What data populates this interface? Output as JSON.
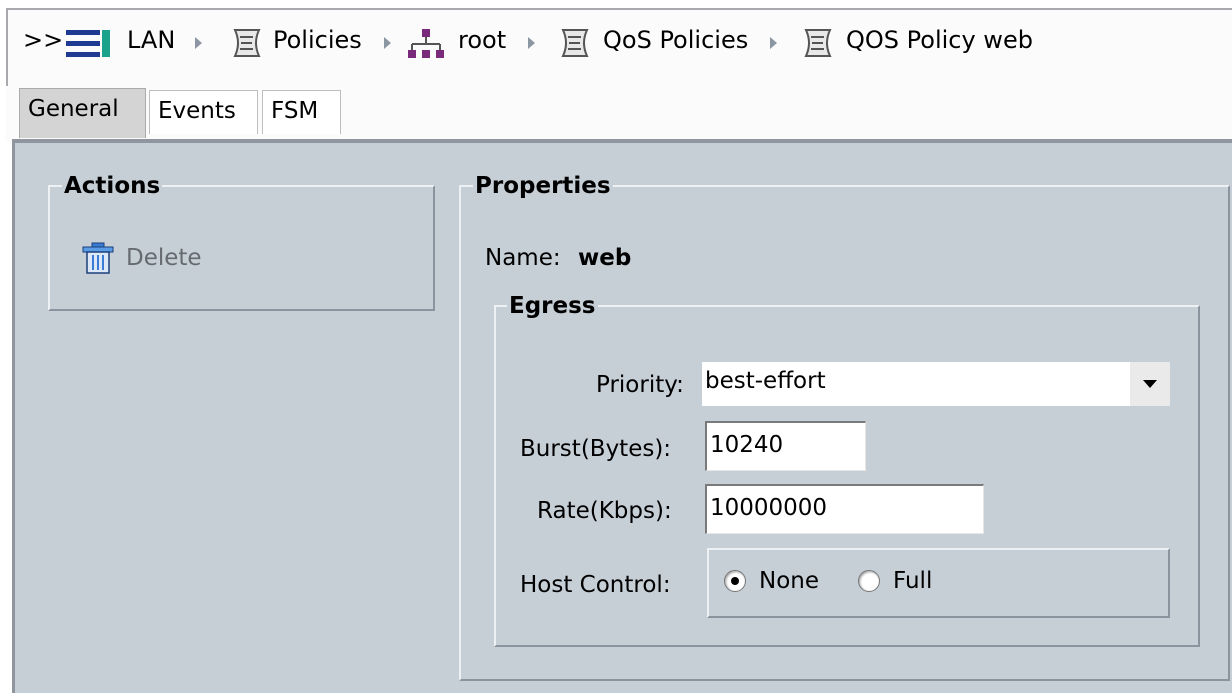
{
  "breadcrumb": {
    "expander": ">>",
    "items": [
      {
        "label": "LAN",
        "icon": "lan-icon"
      },
      {
        "label": "Policies",
        "icon": "policy-scroll-icon"
      },
      {
        "label": "root",
        "icon": "org-tree-icon"
      },
      {
        "label": "QoS Policies",
        "icon": "policy-scroll-icon"
      },
      {
        "label": "QOS Policy web",
        "icon": "policy-scroll-icon"
      }
    ]
  },
  "tabs": [
    {
      "label": "General",
      "selected": true
    },
    {
      "label": "Events",
      "selected": false
    },
    {
      "label": "FSM",
      "selected": false
    }
  ],
  "actions": {
    "title": "Actions",
    "delete_label": "Delete"
  },
  "properties": {
    "title": "Properties",
    "name_label": "Name:",
    "name_value": "web",
    "egress": {
      "title": "Egress",
      "priority_label": "Priority:",
      "priority_value": "best-effort",
      "burst_label": "Burst(Bytes):",
      "burst_value": "10240",
      "rate_label": "Rate(Kbps):",
      "rate_value": "10000000",
      "host_control_label": "Host Control:",
      "host_control_options": [
        {
          "label": "None",
          "selected": true
        },
        {
          "label": "Full",
          "selected": false
        }
      ]
    }
  },
  "colors": {
    "panel_bg": "#c6ced6",
    "lan_icon": "#1f3a93",
    "lan_icon_accent": "#1aa38c",
    "org_icon": "#7a2a7a"
  }
}
